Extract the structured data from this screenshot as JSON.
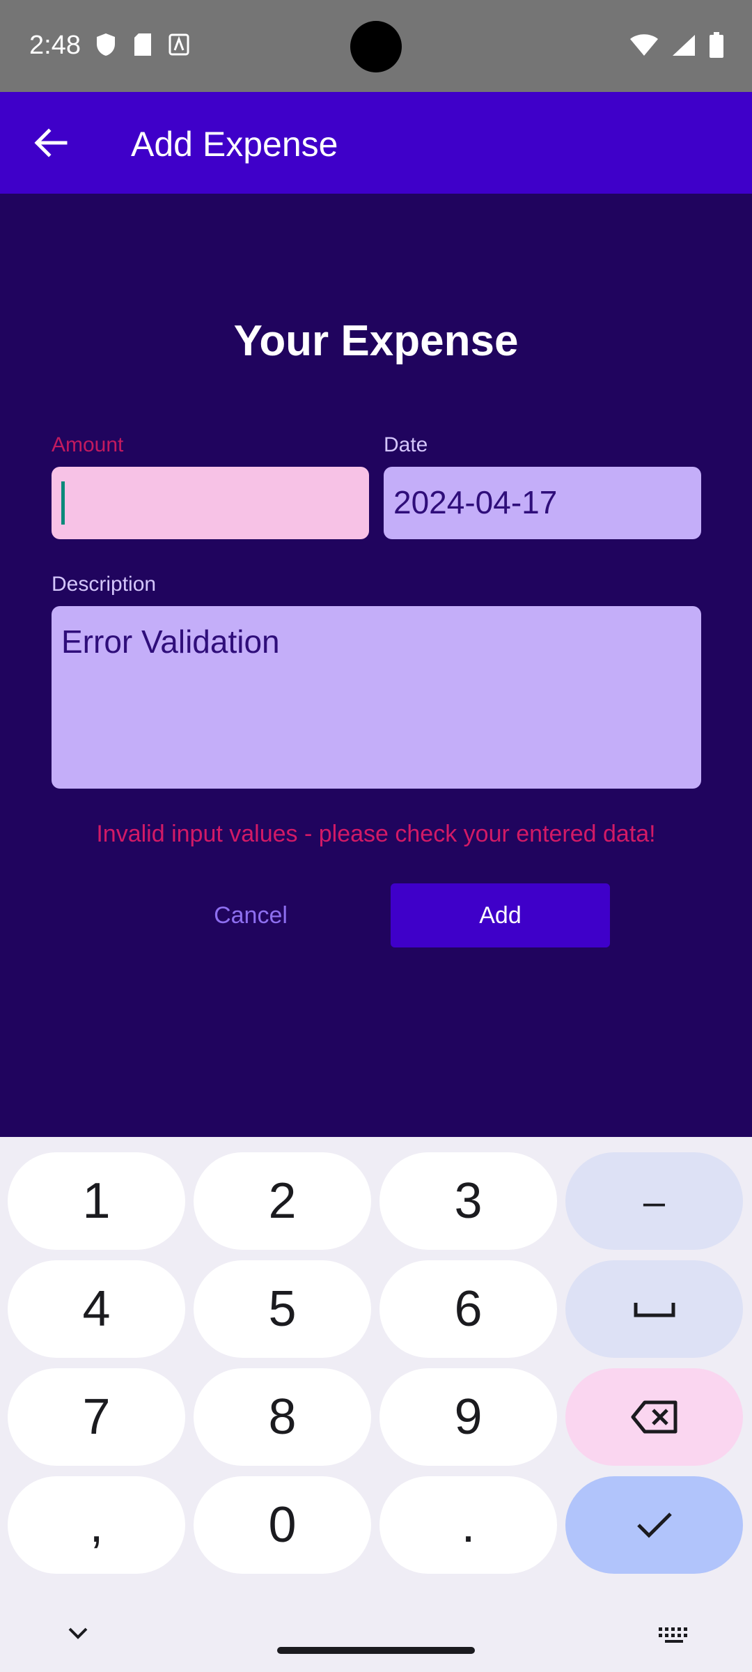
{
  "status_bar": {
    "time": "2:48"
  },
  "app_bar": {
    "title": "Add Expense",
    "back_icon": "arrow-back-icon"
  },
  "form": {
    "heading": "Your Expense",
    "amount": {
      "label": "Amount",
      "value": ""
    },
    "date": {
      "label": "Date",
      "value": "2024-04-17"
    },
    "description": {
      "label": "Description",
      "value": "Error Validation"
    },
    "error": "Invalid input values - please check your entered data!",
    "cancel_label": "Cancel",
    "add_label": "Add"
  },
  "keyboard": {
    "keys": [
      "1",
      "2",
      "3",
      "−",
      "4",
      "5",
      "6",
      "space",
      "7",
      "8",
      "9",
      "backspace",
      ",",
      "0",
      ".",
      "done"
    ],
    "labels": {
      "k1": "1",
      "k2": "2",
      "k3": "3",
      "minus": "–",
      "k4": "4",
      "k5": "5",
      "k6": "6",
      "k7": "7",
      "k8": "8",
      "k9": "9",
      "comma": ",",
      "k0": "0",
      "dot": "."
    }
  },
  "colors": {
    "app_bar": "#3f00c9",
    "background": "#20045e",
    "error": "#d21a66",
    "field": "#c4aef9",
    "field_error": "#f7c2e6"
  }
}
